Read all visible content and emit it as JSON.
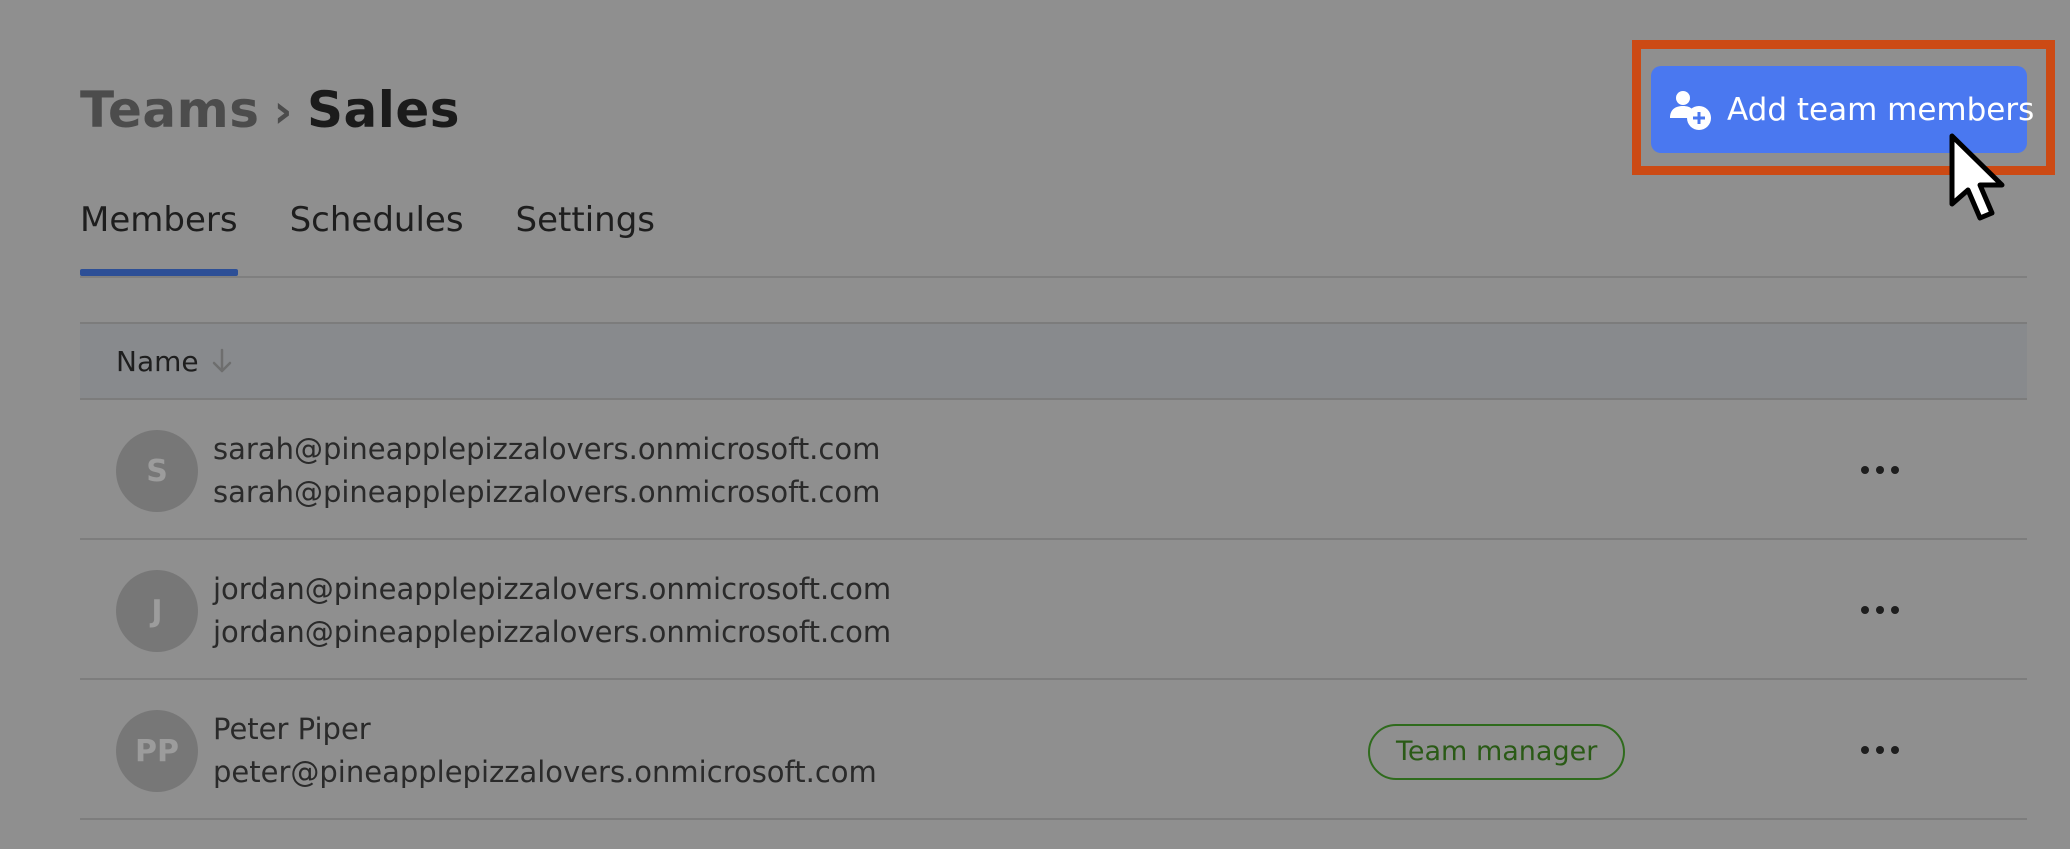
{
  "breadcrumb": {
    "parent": "Teams",
    "separator": "›",
    "current": "Sales"
  },
  "header": {
    "add_button_label": "Add team members",
    "add_button_icon": "add-user-icon",
    "accent_color": "#4a78f0",
    "highlight_color": "#cc4a14"
  },
  "tabs": [
    {
      "label": "Members",
      "active": true
    },
    {
      "label": "Schedules",
      "active": false
    },
    {
      "label": "Settings",
      "active": false
    }
  ],
  "table": {
    "column_name": "Name",
    "sort_icon": "arrow-down-icon",
    "rows": [
      {
        "initials": "S",
        "primary": "sarah@pineapplepizzalovers.onmicrosoft.com",
        "secondary": "sarah@pineapplepizzalovers.onmicrosoft.com",
        "badge": ""
      },
      {
        "initials": "J",
        "primary": "jordan@pineapplepizzalovers.onmicrosoft.com",
        "secondary": "jordan@pineapplepizzalovers.onmicrosoft.com",
        "badge": ""
      },
      {
        "initials": "PP",
        "primary": "Peter Piper",
        "secondary": "peter@pineapplepizzalovers.onmicrosoft.com",
        "badge": "Team manager"
      }
    ]
  }
}
